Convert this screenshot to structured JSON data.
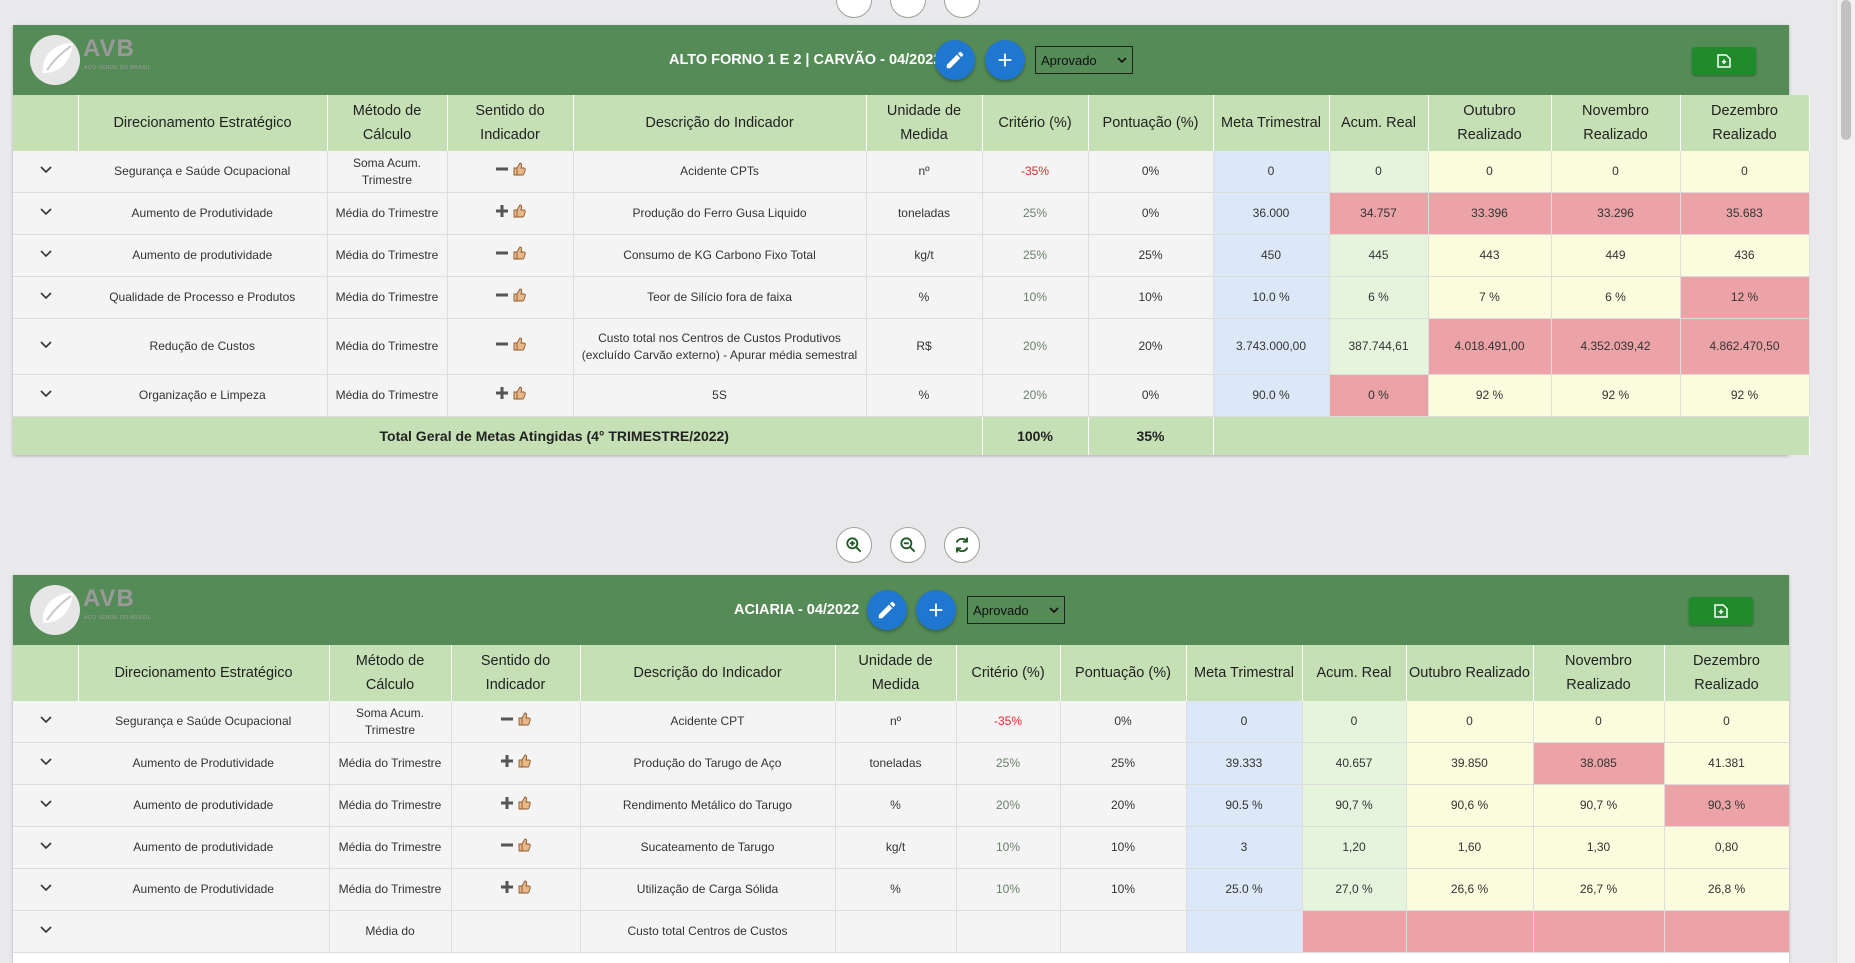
{
  "panels": [
    {
      "title": "ALTO FORNO 1 E 2 | CARVÃO - 04/2022",
      "status": "Aprovado",
      "logo_text": "AVB",
      "logo_sub": "AÇO VERDE DO BRASIL",
      "headers": [
        "",
        "Direcionamento Estratégico",
        "Método de Cálculo",
        "Sentido do Indicador",
        "Descrição do Indicador",
        "Unidade de Medida",
        "Critério (%)",
        "Pontuação (%)",
        "Meta Trimestral",
        "Acum. Real",
        "Outubro Realizado",
        "Novembro Realizado",
        "Dezembro Realizado"
      ],
      "rows": [
        {
          "dir": "Segurança e Saúde Ocupacional",
          "met": "Soma Acum. Trimestre",
          "sent": "minus",
          "desc": "Acidente CPTs",
          "uni": "nº",
          "crit": "-35%",
          "pont": "0%",
          "meta": "0",
          "acum": "0",
          "out": "0",
          "nov": "0",
          "dez": "0",
          "cls": [
            "green",
            "yellow",
            "yellow",
            "yellow"
          ]
        },
        {
          "dir": "Aumento de Produtividade",
          "met": "Média do Trimestre",
          "sent": "plus",
          "desc": "Produção do Ferro Gusa Liquido",
          "uni": "toneladas",
          "crit": "25%",
          "pont": "0%",
          "meta": "36.000",
          "acum": "34.757",
          "out": "33.396",
          "nov": "33.296",
          "dez": "35.683",
          "cls": [
            "red",
            "red",
            "red",
            "red"
          ]
        },
        {
          "dir": "Aumento de produtividade",
          "met": "Média do Trimestre",
          "sent": "minus",
          "desc": "Consumo de KG Carbono Fixo Total",
          "uni": "kg/t",
          "crit": "25%",
          "pont": "25%",
          "meta": "450",
          "acum": "445",
          "out": "443",
          "nov": "449",
          "dez": "436",
          "cls": [
            "green",
            "yellow",
            "yellow",
            "yellow"
          ]
        },
        {
          "dir": "Qualidade de Processo e Produtos",
          "met": "Média do Trimestre",
          "sent": "minus",
          "desc": "Teor de Silício fora de faixa",
          "uni": "%",
          "crit": "10%",
          "pont": "10%",
          "meta": "10.0 %",
          "acum": "6 %",
          "out": "7 %",
          "nov": "6 %",
          "dez": "12 %",
          "cls": [
            "green",
            "yellow",
            "yellow",
            "red"
          ]
        },
        {
          "dir": "Redução de Custos",
          "met": "Média do Trimestre",
          "sent": "minus",
          "desc": "Custo total nos Centros de Custos Produtivos (excluído Carvão externo) - Apurar média semestral",
          "uni": "R$",
          "crit": "20%",
          "pont": "20%",
          "meta": "3.743.000,00",
          "acum": "387.744,61",
          "out": "4.018.491,00",
          "nov": "4.352.039,42",
          "dez": "4.862.470,50",
          "cls": [
            "green",
            "red",
            "red",
            "red"
          ]
        },
        {
          "dir": "Organização e Limpeza",
          "met": "Média do Trimestre",
          "sent": "plus",
          "desc": "5S",
          "uni": "%",
          "crit": "20%",
          "pont": "0%",
          "meta": "90.0 %",
          "acum": "0 %",
          "out": "92 %",
          "nov": "92 %",
          "dez": "92 %",
          "cls": [
            "red",
            "yellow",
            "yellow",
            "yellow"
          ]
        }
      ],
      "total": {
        "label": "Total Geral de Metas Atingidas (4° TRIMESTRE/2022)",
        "crit": "100%",
        "pont": "35%"
      }
    },
    {
      "title": "ACIARIA - 04/2022",
      "status": "Aprovado",
      "logo_text": "AVB",
      "logo_sub": "AÇO VERDE DO BRASIL",
      "headers": [
        "",
        "Direcionamento Estratégico",
        "Método de Cálculo",
        "Sentido do Indicador",
        "Descrição do Indicador",
        "Unidade de Medida",
        "Critério (%)",
        "Pontuação (%)",
        "Meta Trimestral",
        "Acum. Real",
        "Outubro Realizado",
        "Novembro Realizado",
        "Dezembro Realizado"
      ],
      "rows": [
        {
          "dir": "Segurança e Saúde Ocupacional",
          "met": "Soma Acum. Trimestre",
          "sent": "minus",
          "desc": "Acidente CPT",
          "uni": "nº",
          "crit": "-35%",
          "pont": "0%",
          "meta": "0",
          "acum": "0",
          "out": "0",
          "nov": "0",
          "dez": "0",
          "cls": [
            "green",
            "yellow",
            "yellow",
            "yellow"
          ]
        },
        {
          "dir": "Aumento de Produtividade",
          "met": "Média do Trimestre",
          "sent": "plus",
          "desc": "Produção do Tarugo de Aço",
          "uni": "toneladas",
          "crit": "25%",
          "pont": "25%",
          "meta": "39.333",
          "acum": "40.657",
          "out": "39.850",
          "nov": "38.085",
          "dez": "41.381",
          "cls": [
            "green",
            "yellow",
            "red",
            "yellow"
          ]
        },
        {
          "dir": "Aumento de produtividade",
          "met": "Média do Trimestre",
          "sent": "plus",
          "desc": "Rendimento Metálico do Tarugo",
          "uni": "%",
          "crit": "20%",
          "pont": "20%",
          "meta": "90.5 %",
          "acum": "90,7 %",
          "out": "90,6 %",
          "nov": "90,7 %",
          "dez": "90,3 %",
          "cls": [
            "green",
            "yellow",
            "yellow",
            "red"
          ]
        },
        {
          "dir": "Aumento de produtividade",
          "met": "Média do Trimestre",
          "sent": "minus",
          "desc": "Sucateamento de Tarugo",
          "uni": "kg/t",
          "crit": "10%",
          "pont": "10%",
          "meta": "3",
          "acum": "1,20",
          "out": "1,60",
          "nov": "1,30",
          "dez": "0,80",
          "cls": [
            "green",
            "yellow",
            "yellow",
            "yellow"
          ]
        },
        {
          "dir": "Aumento de Produtividade",
          "met": "Média do Trimestre",
          "sent": "plus",
          "desc": "Utilização de Carga Sólida",
          "uni": "%",
          "crit": "10%",
          "pont": "10%",
          "meta": "25.0 %",
          "acum": "27,0 %",
          "out": "26,6 %",
          "nov": "26,7 %",
          "dez": "26,8 %",
          "cls": [
            "green",
            "yellow",
            "yellow",
            "yellow"
          ]
        },
        {
          "dir": "",
          "met": "Média do",
          "sent": "none",
          "desc": "Custo total Centros de Custos",
          "uni": "",
          "crit": "",
          "pont": "",
          "meta": "",
          "acum": "",
          "out": "",
          "nov": "",
          "dez": "",
          "cls": [
            "red",
            "red",
            "red",
            "red"
          ]
        }
      ]
    }
  ]
}
